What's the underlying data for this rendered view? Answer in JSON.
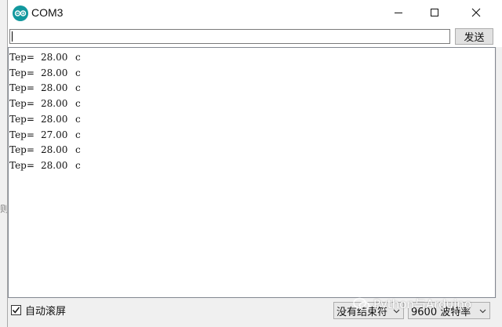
{
  "left_edge_glyph": "则",
  "window": {
    "title": "COM3",
    "icon": "arduino-icon",
    "controls": [
      "minimize-icon",
      "maximize-icon",
      "close-icon"
    ]
  },
  "send_row": {
    "input_value": "",
    "send_label": "发送"
  },
  "monitor": {
    "lines": [
      {
        "tag": "Tep=",
        "value": "28.00",
        "unit": "c"
      },
      {
        "tag": "Tep=",
        "value": "28.00",
        "unit": "c"
      },
      {
        "tag": "Tep=",
        "value": "28.00",
        "unit": "c"
      },
      {
        "tag": "Tep=",
        "value": "28.00",
        "unit": "c"
      },
      {
        "tag": "Tep=",
        "value": "28.00",
        "unit": "c"
      },
      {
        "tag": "Tep=",
        "value": "27.00",
        "unit": "c"
      },
      {
        "tag": "Tep=",
        "value": "28.00",
        "unit": "c"
      },
      {
        "tag": "Tep=",
        "value": "28.00",
        "unit": "c"
      }
    ]
  },
  "status_bar": {
    "autoscroll_label": "自动滚屏",
    "autoscroll_checked": true,
    "line_ending_selected": "没有结束符",
    "baud_selected": "9600 波特率"
  },
  "watermark": {
    "text": "Python与Arduino"
  },
  "colors": {
    "accent": "#12989e",
    "titlebar": "#ffffff",
    "statusbar": "#f0f0f0"
  }
}
